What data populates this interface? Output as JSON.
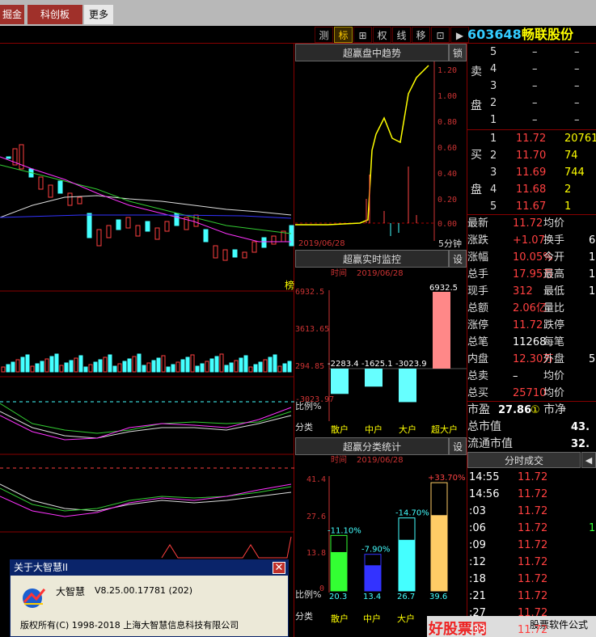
{
  "tabs": [
    {
      "label": "掘金"
    },
    {
      "label": "科创板"
    },
    {
      "label": "更多"
    }
  ],
  "toolbar": {
    "buttons": [
      {
        "label": "测"
      },
      {
        "label": "标"
      },
      {
        "label": "⊞"
      },
      {
        "label": "权"
      },
      {
        "label": "线"
      },
      {
        "label": "移"
      },
      {
        "label": "⊡"
      },
      {
        "label": "▶"
      }
    ]
  },
  "stock": {
    "code": "603648",
    "name": "畅联股份"
  },
  "trend": {
    "title": "超赢盘中趋势",
    "lock": "锁",
    "date": "2019/06/28",
    "period": "5分钟",
    "y_ticks": [
      "1.20",
      "1.00",
      "0.80",
      "0.60",
      "0.40",
      "0.20",
      "0.00"
    ],
    "side_label": "榜"
  },
  "monitor": {
    "title": "超赢实时监控",
    "settings": "设",
    "time_label": "时间",
    "date": "2019/06/28",
    "y_ticks": [
      "6932.5",
      "3613.65",
      "294.85",
      "-3023.97"
    ],
    "ratio_label": "比例%",
    "values": [
      "-2283.4",
      "-1625.1",
      "-3023.9",
      "6932.5"
    ],
    "categories": [
      "分类",
      "散户",
      "中户",
      "大户",
      "超大户"
    ]
  },
  "stats": {
    "title": "超赢分类统计",
    "settings": "设",
    "time_label": "时间",
    "date": "2019/06/28",
    "y_ticks": [
      "41.4",
      "27.6",
      "13.8",
      "0"
    ],
    "ratio_label": "比例%",
    "pct": [
      "-11.10%",
      "-7.90%",
      "-14.70%",
      "+33.70%"
    ],
    "ratios": [
      "20.3",
      "13.4",
      "26.7",
      "39.6"
    ],
    "categories": [
      "分类",
      "散户",
      "中户",
      "大户"
    ]
  },
  "sell": {
    "label1": "卖",
    "label2": "盘",
    "rows": [
      {
        "n": "5",
        "p": "–",
        "v": "–"
      },
      {
        "n": "4",
        "p": "–",
        "v": "–"
      },
      {
        "n": "3",
        "p": "–",
        "v": "–"
      },
      {
        "n": "2",
        "p": "–",
        "v": "–"
      },
      {
        "n": "1",
        "p": "–",
        "v": "–"
      }
    ]
  },
  "buy": {
    "label1": "买",
    "label2": "盘",
    "rows": [
      {
        "n": "1",
        "p": "11.72",
        "v": "20761"
      },
      {
        "n": "2",
        "p": "11.70",
        "v": "74"
      },
      {
        "n": "3",
        "p": "11.69",
        "v": "744"
      },
      {
        "n": "4",
        "p": "11.68",
        "v": "2"
      },
      {
        "n": "5",
        "p": "11.67",
        "v": "1"
      }
    ]
  },
  "quote": [
    {
      "k1": "最新",
      "v1": "11.72",
      "k2": "均价",
      "v2": ""
    },
    {
      "k1": "涨跌",
      "v1": "+1.07",
      "k2": "换手",
      "v2": "6"
    },
    {
      "k1": "涨幅",
      "v1": "10.05%",
      "k2": "今开",
      "v2": "1"
    },
    {
      "k1": "总手",
      "v1": "17.95万",
      "k2": "最高",
      "v2": "1"
    },
    {
      "k1": "现手",
      "v1": "312",
      "k2": "最低",
      "v2": "1"
    },
    {
      "k1": "总额",
      "v1": "2.06亿",
      "k2": "量比",
      "v2": ""
    },
    {
      "k1": "涨停",
      "v1": "11.72",
      "k2": "跌停",
      "v2": ""
    },
    {
      "k1": "总笔",
      "v1": "11268",
      "k2": "每笔",
      "v2": ""
    },
    {
      "k1": "内盘",
      "v1": "12.30万",
      "k2": "外盘",
      "v2": "5"
    },
    {
      "k1": "总卖",
      "v1": "–",
      "k2": "均价",
      "v2": ""
    },
    {
      "k1": "总买",
      "v1": "25710",
      "k2": "均价",
      "v2": ""
    }
  ],
  "fund": [
    {
      "k": "市盈",
      "v": "27.86",
      "badge": "①",
      "k2": "市净"
    },
    {
      "k": "总市值",
      "v": "43."
    },
    {
      "k": "流通市值",
      "v": "32."
    }
  ],
  "trades": {
    "title": "分时成交",
    "rows": [
      {
        "t": "14:55",
        "p": "11.72",
        "v": ""
      },
      {
        "t": "14:56",
        "p": "11.72",
        "v": ""
      },
      {
        "t": ":03",
        "p": "11.72",
        "v": ""
      },
      {
        "t": ":06",
        "p": "11.72",
        "v": "1"
      },
      {
        "t": ":09",
        "p": "11.72",
        "v": ""
      },
      {
        "t": ":12",
        "p": "11.72",
        "v": ""
      },
      {
        "t": ":18",
        "p": "11.72",
        "v": ""
      },
      {
        "t": ":21",
        "p": "11.72",
        "v": ""
      },
      {
        "t": ":27",
        "p": "11.72",
        "v": ""
      },
      {
        "t": ":33",
        "p": "11.72",
        "v": ""
      }
    ]
  },
  "about": {
    "title": "关于大智慧II",
    "product": "大智慧",
    "version": "V8.25.00.17781 (202)",
    "copyright": "版权所有(C) 1998-2018  上海大智慧信息科技有限公司",
    "close": "✕"
  },
  "watermark": {
    "text1": "好股票网",
    "text2": "股票软件公式"
  },
  "colors": {
    "up": "#ff4040",
    "down": "#4ff",
    "accent": "#ff0"
  }
}
